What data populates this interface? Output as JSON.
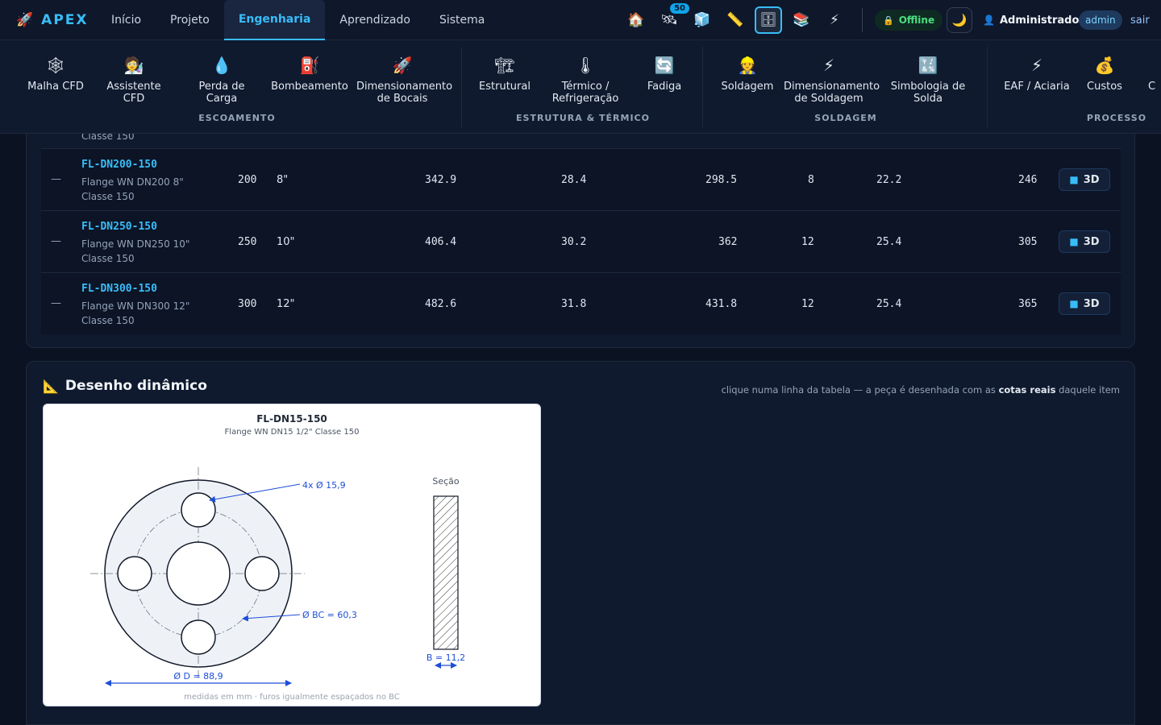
{
  "app": {
    "name": "APEX"
  },
  "nav": {
    "items": [
      {
        "label": "Início",
        "active": false
      },
      {
        "label": "Projeto",
        "active": false
      },
      {
        "label": "Engenharia",
        "active": true
      },
      {
        "label": "Aprendizado",
        "active": false
      },
      {
        "label": "Sistema",
        "active": false
      }
    ]
  },
  "toolbar": {
    "notification_count": "50",
    "status": "Offline",
    "user_name": "Administrador",
    "role": "admin",
    "logout": "sair"
  },
  "submenu": {
    "groups": [
      {
        "label": "ESCOAMENTO",
        "items": [
          "Malha CFD",
          "Assistente CFD",
          "Perda de Carga",
          "Bombeamento",
          "Dimensionamento de Bocais"
        ]
      },
      {
        "label": "ESTRUTURA & TÉRMICO",
        "items": [
          "Estrutural",
          "Térmico / Refrigeração",
          "Fadiga"
        ]
      },
      {
        "label": "SOLDAGEM",
        "items": [
          "Soldagem",
          "Dimensionamento de Soldagem",
          "Simbologia de Solda"
        ]
      },
      {
        "label": "PROCESSO",
        "items": [
          "EAF / Aciaria",
          "Custos"
        ]
      }
    ]
  },
  "table": {
    "partial_row_desc": "Classe 150",
    "rows": [
      {
        "mark": "—",
        "code": "FL-DN200-150",
        "desc1": "Flange WN DN200 8\"",
        "desc2": "Classe 150",
        "dn": "200",
        "inch": "8\"",
        "d": "342.9",
        "b": "28.4",
        "bc": "298.5",
        "holes": "8",
        "hole_d": "22.2",
        "mass": "246",
        "btn": "3D"
      },
      {
        "mark": "—",
        "code": "FL-DN250-150",
        "desc1": "Flange WN DN250 10\"",
        "desc2": "Classe 150",
        "dn": "250",
        "inch": "10\"",
        "d": "406.4",
        "b": "30.2",
        "bc": "362",
        "holes": "12",
        "hole_d": "25.4",
        "mass": "305",
        "btn": "3D"
      },
      {
        "mark": "—",
        "code": "FL-DN300-150",
        "desc1": "Flange WN DN300 12\"",
        "desc2": "Classe 150",
        "dn": "300",
        "inch": "12\"",
        "d": "482.6",
        "b": "31.8",
        "bc": "431.8",
        "holes": "12",
        "hole_d": "25.4",
        "mass": "365",
        "btn": "3D"
      }
    ]
  },
  "drawing": {
    "title": "Desenho dinâmico",
    "hint_pre": "clique numa linha da tabela — a peça é desenhada com as ",
    "hint_bold": "cotas reais",
    "hint_post": " daquele item",
    "part_code": "FL-DN15-150",
    "part_desc": "Flange WN DN15 1/2\" Classe 150",
    "holes_label": "4x Ø 15,9",
    "bc_label": "Ø BC = 60,3",
    "d_label": "Ø D = 88,9",
    "section_label": "Seção",
    "b_label": "B = 11,2",
    "footer": "medidas em mm · furos igualmente espaçados no BC"
  },
  "colors": {
    "accent": "#38bdf8",
    "dimension": "#1d4ed8",
    "status_ok": "#4ade80"
  }
}
